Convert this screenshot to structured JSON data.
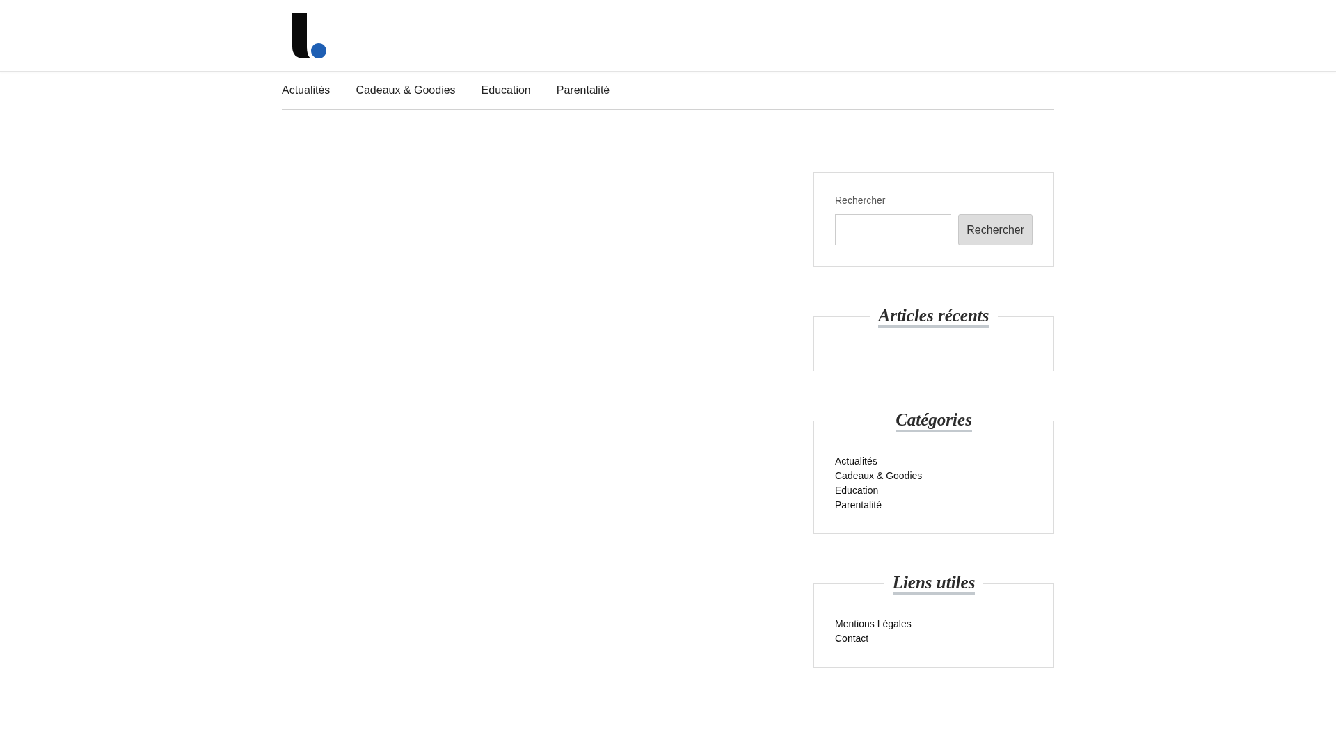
{
  "nav": {
    "items": [
      "Actualités",
      "Cadeaux & Goodies",
      "Education",
      "Parentalité"
    ]
  },
  "sidebar": {
    "search": {
      "label": "Rechercher",
      "button": "Rechercher"
    },
    "widgets": [
      {
        "title": "Articles récents"
      },
      {
        "title": "Catégories",
        "links": [
          "Actualités",
          "Cadeaux & Goodies",
          "Education",
          "Parentalité"
        ]
      },
      {
        "title": "Liens utiles",
        "links": [
          "Mentions Légales",
          "Contact"
        ]
      }
    ]
  }
}
